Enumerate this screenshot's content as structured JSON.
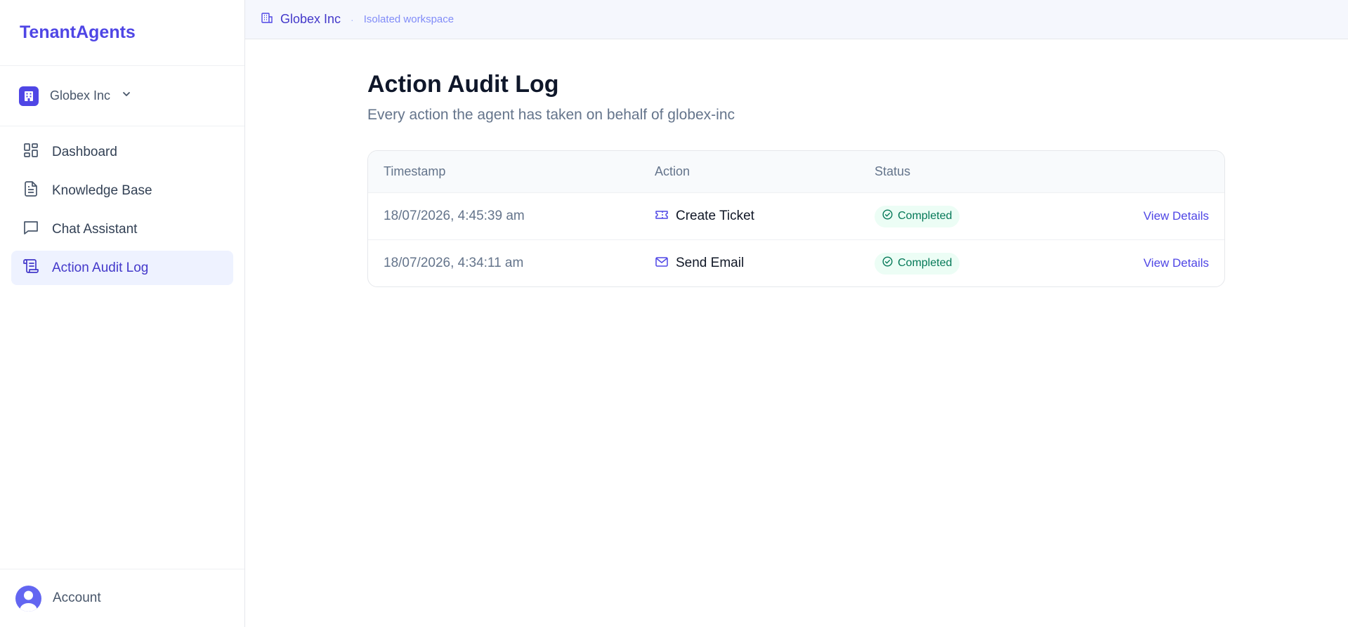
{
  "brand": {
    "name": "TenantAgents"
  },
  "tenant_switcher": {
    "name": "Globex Inc",
    "icon": "building-icon"
  },
  "sidebar": {
    "items": [
      {
        "label": "Dashboard",
        "icon": "dashboard-grid-icon",
        "active": false
      },
      {
        "label": "Knowledge Base",
        "icon": "document-icon",
        "active": false
      },
      {
        "label": "Chat Assistant",
        "icon": "chat-bubble-icon",
        "active": false
      },
      {
        "label": "Action Audit Log",
        "icon": "scroll-log-icon",
        "active": true
      }
    ]
  },
  "account": {
    "label": "Account"
  },
  "topbar": {
    "tenant": "Globex Inc",
    "separator": "·",
    "workspace": "Isolated workspace"
  },
  "page": {
    "title": "Action Audit Log",
    "subtitle": "Every action the agent has taken on behalf of globex-inc"
  },
  "table": {
    "headers": {
      "timestamp": "Timestamp",
      "action": "Action",
      "status": "Status"
    },
    "rows": [
      {
        "timestamp": "18/07/2026, 4:45:39 am",
        "action": "Create Ticket",
        "action_icon": "ticket-icon",
        "status": "Completed",
        "link": "View Details"
      },
      {
        "timestamp": "18/07/2026, 4:34:11 am",
        "action": "Send Email",
        "action_icon": "mail-icon",
        "status": "Completed",
        "link": "View Details"
      }
    ]
  },
  "colors": {
    "accent": "#4f46e5",
    "active_bg": "#eef2ff",
    "success_bg": "#ecfdf5",
    "success_text": "#047857"
  }
}
